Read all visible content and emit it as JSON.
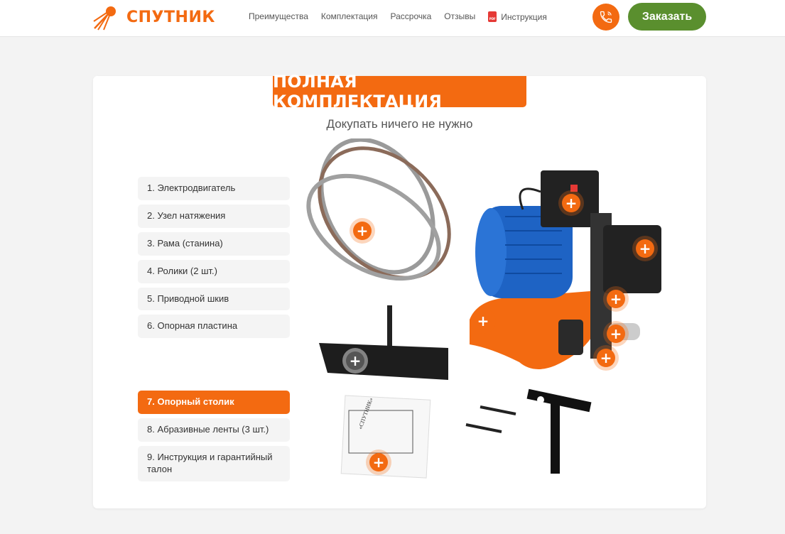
{
  "header": {
    "logo_text": "СПУТНИК",
    "nav": [
      "Преимущества",
      "Комплектация",
      "Рассрочка",
      "Отзывы"
    ],
    "nav_pdf_label": "Инструкция",
    "order_label": "Заказать"
  },
  "section": {
    "title": "ПОЛНАЯ КОМПЛЕКТАЦИЯ",
    "subtitle": "Докупать ничего не нужно",
    "items_top": [
      "1. Электродвигатель",
      "2. Узел натяжения",
      "3. Рама (станина)",
      "4. Ролики (2 шт.)",
      "5. Приводной шкив",
      "6. Опорная пластина"
    ],
    "items_bottom": [
      "7. Опорный столик",
      "8. Абразивные ленты (3 шт.)",
      "9. Инструкция и гарантийный талон"
    ],
    "active_item": "7. Опорный столик",
    "manual_cover_text": "«СПУТНИК»"
  },
  "colors": {
    "accent": "#f36a11",
    "order_button": "#5a8f2e",
    "motor_blue": "#1565c0"
  }
}
